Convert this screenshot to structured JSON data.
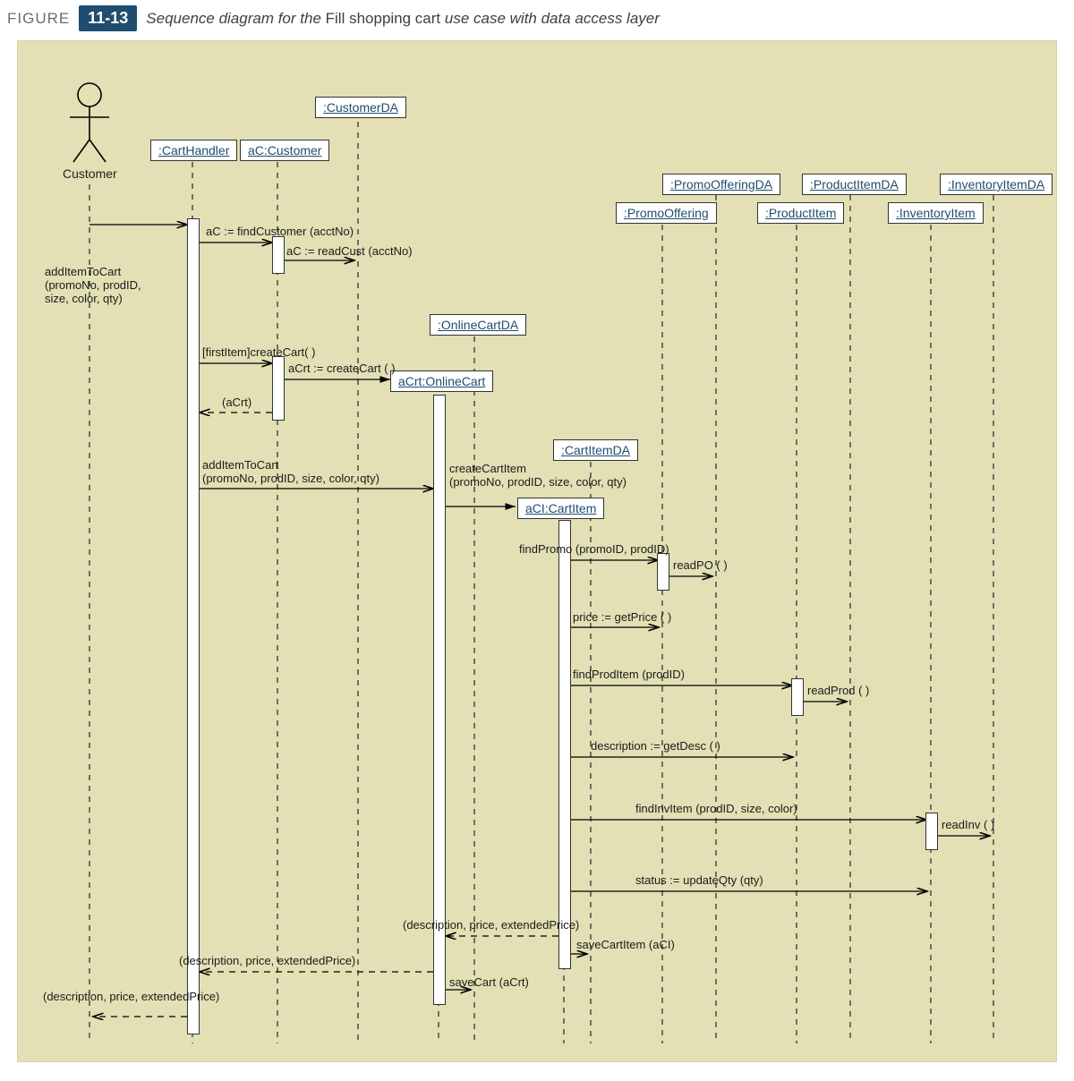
{
  "caption": {
    "figure_word": "FIGURE",
    "figure_num": "11-13",
    "desc_prefix_italic": "Sequence diagram for the ",
    "desc_plain": "Fill shopping cart",
    "desc_suffix_italic": " use case with data access layer"
  },
  "actor": {
    "label": "Customer"
  },
  "lifelines": {
    "cartHandler": ":CartHandler",
    "acCustomer": "aC:Customer",
    "customerDA": ":CustomerDA",
    "onlineCartDA": ":OnlineCartDA",
    "aCrtOnlineCart": "aCrt:OnlineCart",
    "cartItemDA": ":CartItemDA",
    "aCICartItem": "aCI:CartItem",
    "promoOffering": ":PromoOffering",
    "promoOfferingDA": ":PromoOfferingDA",
    "productItem": ":ProductItem",
    "productItemDA": ":ProductItemDA",
    "inventoryItem": ":InventoryItem",
    "inventoryItemDA": ":InventoryItemDA"
  },
  "messages": {
    "addItemToCart_actor": "addItemToCart\n(promoNo, prodID,\nsize, color, qty)",
    "findCustomer": "aC := findCustomer (acctNo)",
    "readCust": "aC := readCust (acctNo)",
    "createCartGuard": "[firstItem]createCart( )",
    "createCart": "aCrt := createCart ( )",
    "return_aCrt": "(aCrt)",
    "addItemToCart_msg": "addItemToCart\n(promoNo, prodID, size, color, qty)",
    "createCartItem": "createCartItem\n(promoNo, prodID, size, color, qty)",
    "findPromo": "findPromo (promoID, prodID)",
    "readPO": "readPO ( )",
    "getPrice": "price := getPrice ( )",
    "findProdItem": "findProdItem (prodID)",
    "readProd": "readProd ( )",
    "getDesc": "description := getDesc ( )",
    "findInvItem": "findInvItem (prodID, size, color)",
    "readInv": "readInv ( )",
    "updateQty": "status := updateQty (qty)",
    "return_desc1": "(description, price, extendedPrice)",
    "return_desc2": "(description, price, extendedPrice)",
    "return_desc3": "(description, price, extendedPrice)",
    "saveCartItem": "saveCartItem (aCI)",
    "saveCart": "saveCart (aCrt)"
  }
}
